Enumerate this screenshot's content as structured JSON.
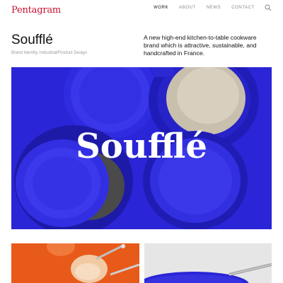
{
  "header": {
    "logo": "Pentagram",
    "nav": [
      "WORK",
      "ABOUT",
      "NEWS",
      "CONTACT"
    ],
    "search_icon": "search-icon"
  },
  "project": {
    "title": "Soufflé",
    "tags": "Brand Identity, Industrial/Product Design",
    "description": "A new high-end kitchen-to-table cookware brand which is attractive, sustainable, and handcrafted in France."
  },
  "hero": {
    "wordmark": "Soufflé",
    "lid_text": "Soufflé"
  },
  "colors": {
    "brand_red": "#c8102e",
    "hero_blue": "#2a25d6",
    "thumb_orange": "#e85a1a",
    "thumb_grey": "#e6e6e6"
  }
}
